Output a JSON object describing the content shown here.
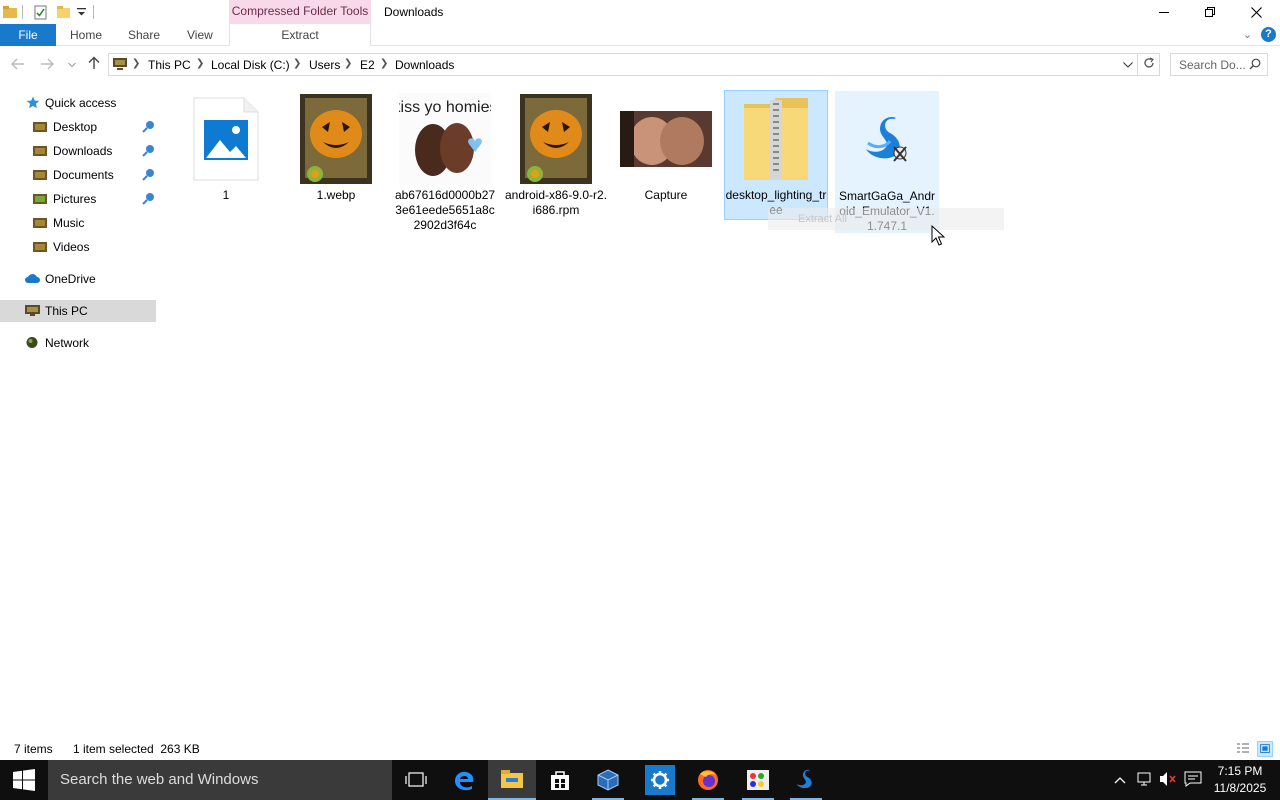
{
  "title_bar": {
    "context_tab": "Compressed Folder Tools",
    "window_title": "Downloads",
    "minimize_icon": "minimize-icon",
    "restore_icon": "restore-icon",
    "close_icon": "close-icon"
  },
  "ribbon": {
    "file": "File",
    "home": "Home",
    "share": "Share",
    "view": "View",
    "extract": "Extract",
    "help": "?"
  },
  "address": {
    "crumbs": [
      "This PC",
      "Local Disk (C:)",
      "Users",
      "E2",
      "Downloads"
    ],
    "search_placeholder": "Search Do..."
  },
  "nav": {
    "quick_access": "Quick access",
    "items": [
      "Desktop",
      "Downloads",
      "Documents",
      "Pictures",
      "Music",
      "Videos"
    ],
    "onedrive": "OneDrive",
    "this_pc": "This PC",
    "network": "Network"
  },
  "files": [
    {
      "name": "1",
      "type": "image-file"
    },
    {
      "name": "1.webp",
      "type": "pumpkin-image"
    },
    {
      "name": "ab67616d0000b273e61eede5651a8c2902d3f64c",
      "type": "photo"
    },
    {
      "name": "android-x86-9.0-r2.i686.rpm",
      "type": "pumpkin-image"
    },
    {
      "name": "Capture",
      "type": "photo"
    },
    {
      "name": "desktop_lighting_tree",
      "type": "zip-folder",
      "selected": true
    },
    {
      "name": "SmartGaGa_Android_Emulator_V1.1.747.1",
      "type": "app-icon",
      "hover": true
    }
  ],
  "thumb_captions": {
    "kiss": "kiss yo homies"
  },
  "drag_label": "Extract All",
  "status": {
    "items": "7 items",
    "selected": "1 item selected  263 KB"
  },
  "taskbar": {
    "search_text": "Search the web and Windows",
    "time": "7:15 PM",
    "date": "11/8/2025"
  },
  "colors": {
    "accent": "#1979ca",
    "context_tab": "#f8d9ea",
    "selection": "#cce8ff"
  }
}
